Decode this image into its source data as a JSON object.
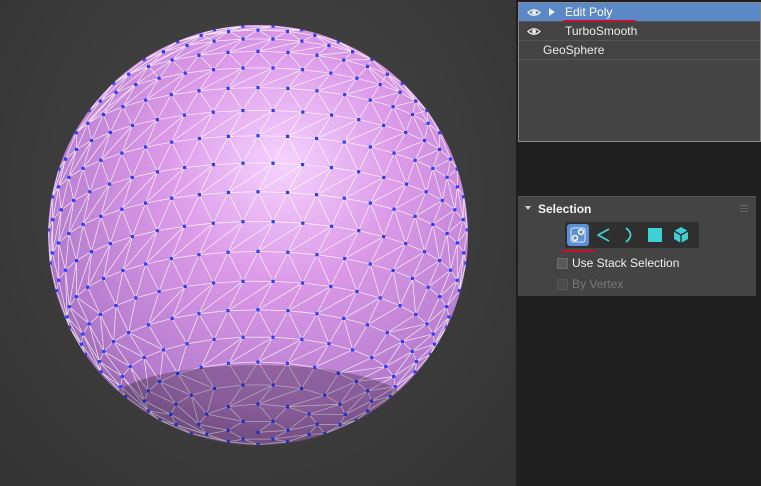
{
  "modifier_stack": {
    "items": [
      {
        "label": "Edit Poly",
        "visible": true,
        "expandable": true,
        "selected": true
      },
      {
        "label": "TurboSmooth",
        "visible": true,
        "expandable": false,
        "selected": false
      },
      {
        "label": "GeoSphere",
        "visible": false,
        "expandable": false,
        "selected": false
      }
    ]
  },
  "selection_rollout": {
    "title": "Selection",
    "subobject_buttons": [
      {
        "name": "vertex",
        "icon": "vertex-icon",
        "active": true
      },
      {
        "name": "edge",
        "icon": "edge-icon",
        "active": false
      },
      {
        "name": "border",
        "icon": "border-icon",
        "active": false
      },
      {
        "name": "polygon",
        "icon": "polygon-icon",
        "active": false
      },
      {
        "name": "element",
        "icon": "element-icon",
        "active": false
      }
    ],
    "use_stack_selection_label": "Use Stack Selection",
    "use_stack_selection_checked": false,
    "by_vertex_label": "By Vertex",
    "by_vertex_checked": false,
    "by_vertex_enabled": false
  },
  "colors": {
    "selected_row": "#5b89c8",
    "sphere_fill": "#d28ae6",
    "vertex_blue": "#2f3cff",
    "accent_teal": "#3fd0d4",
    "annotation_red": "#c8102e"
  }
}
